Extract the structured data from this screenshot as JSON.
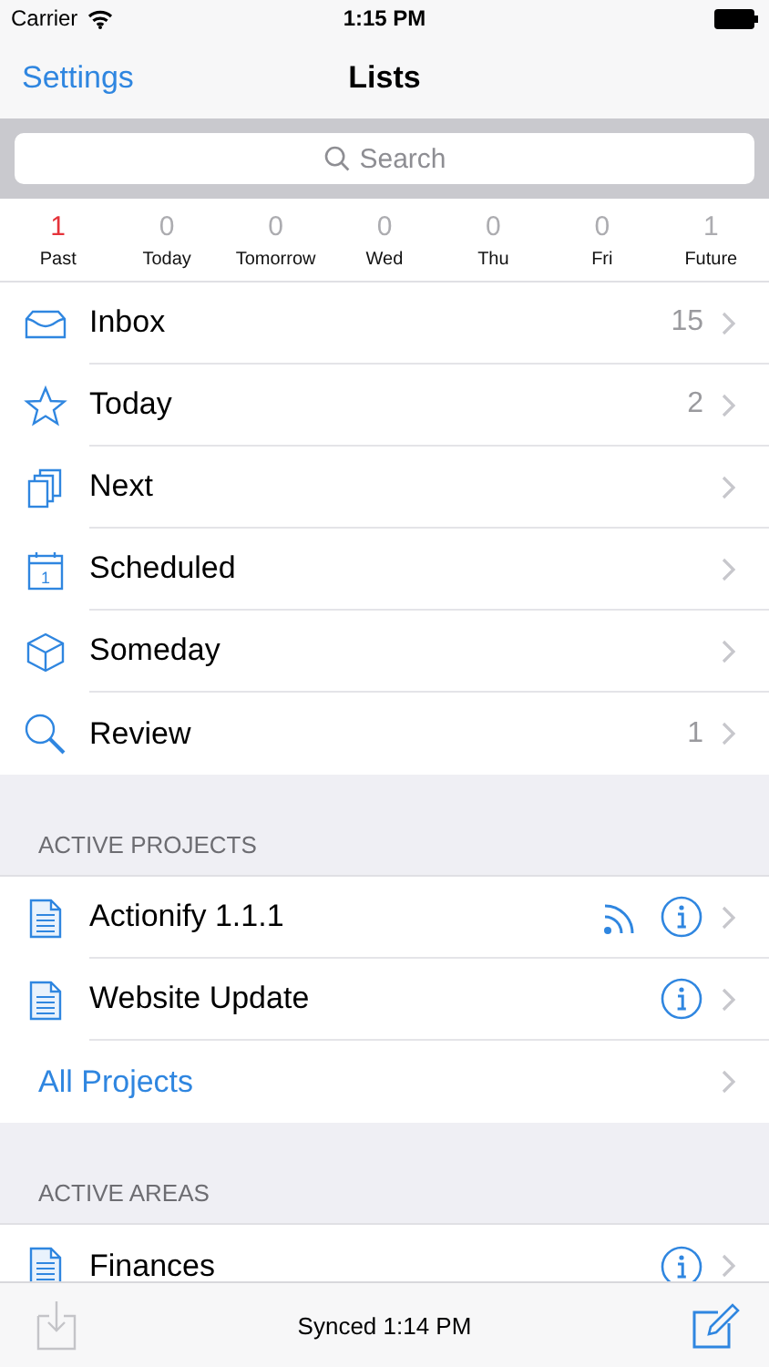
{
  "status_bar": {
    "carrier": "Carrier",
    "time": "1:15 PM"
  },
  "nav": {
    "back": "Settings",
    "title": "Lists"
  },
  "search": {
    "placeholder": "Search"
  },
  "days": [
    {
      "count": "1",
      "label": "Past",
      "overdue": true
    },
    {
      "count": "0",
      "label": "Today",
      "overdue": false
    },
    {
      "count": "0",
      "label": "Tomorrow",
      "overdue": false
    },
    {
      "count": "0",
      "label": "Wed",
      "overdue": false
    },
    {
      "count": "0",
      "label": "Thu",
      "overdue": false
    },
    {
      "count": "0",
      "label": "Fri",
      "overdue": false
    },
    {
      "count": "1",
      "label": "Future",
      "overdue": false
    }
  ],
  "lists": [
    {
      "kind": "inbox",
      "label": "Inbox",
      "count": "15"
    },
    {
      "kind": "star",
      "label": "Today",
      "count": "2"
    },
    {
      "kind": "stack",
      "label": "Next"
    },
    {
      "kind": "calendar",
      "label": "Scheduled",
      "icon_text": "1"
    },
    {
      "kind": "cube",
      "label": "Someday"
    },
    {
      "kind": "search",
      "label": "Review",
      "count": "1"
    }
  ],
  "sections": [
    {
      "header": "ACTIVE PROJECTS",
      "rows": [
        {
          "kind": "document",
          "label": "Actionify 1.1.1",
          "feed": true,
          "info": true
        },
        {
          "kind": "document",
          "label": "Website Update",
          "feed": false,
          "info": true
        },
        {
          "kind": "link",
          "label": "All Projects",
          "feed": false,
          "info": false
        }
      ]
    },
    {
      "header": "ACTIVE AREAS",
      "rows": [
        {
          "kind": "document",
          "label": "Finances",
          "feed": false,
          "info": true
        }
      ]
    }
  ],
  "toolbar": {
    "import_disabled": true,
    "status": "Synced 1:14 PM"
  }
}
